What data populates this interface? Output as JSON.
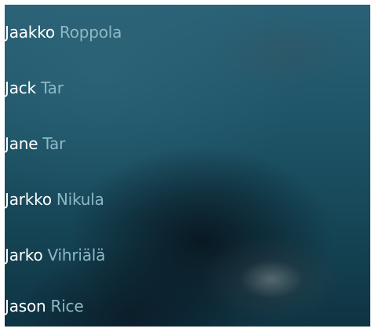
{
  "contacts": [
    {
      "first_name": "Jaakko",
      "last_name": "Roppola"
    },
    {
      "first_name": "Jack",
      "last_name": "Tar"
    },
    {
      "first_name": "Jane",
      "last_name": "Tar"
    },
    {
      "first_name": "Jarkko",
      "last_name": "Nikula"
    },
    {
      "first_name": "Jarko",
      "last_name": "Vihriälä"
    },
    {
      "first_name": "Jason",
      "last_name": "Rice"
    }
  ],
  "colors": {
    "first_name": "#ffffff",
    "last_name": "#8fb8c6",
    "background": "#1e5568"
  }
}
